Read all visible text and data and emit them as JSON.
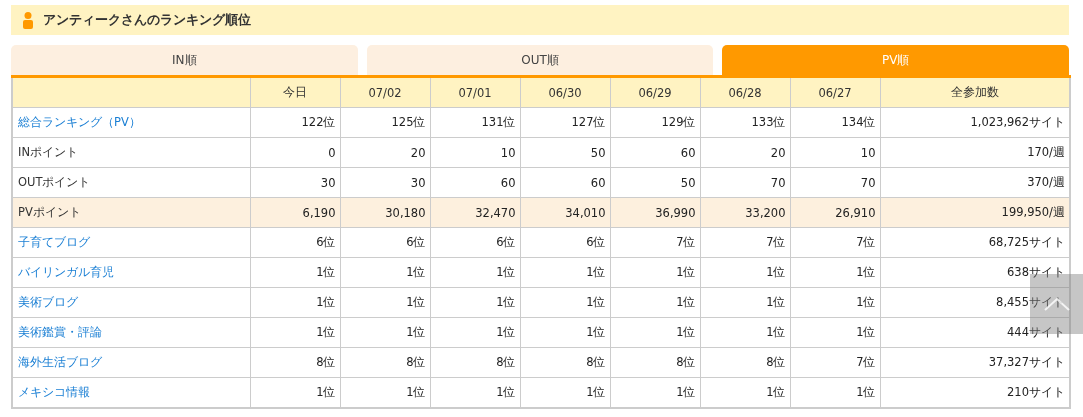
{
  "heading": "アンティークさんのランキング順位",
  "tabs": [
    {
      "label": "IN順",
      "selected": false
    },
    {
      "label": "OUT順",
      "selected": false
    },
    {
      "label": "PV順",
      "selected": true
    }
  ],
  "table": {
    "columns": [
      "",
      "今日",
      "07/02",
      "07/01",
      "06/30",
      "06/29",
      "06/28",
      "06/27",
      "全参加数"
    ],
    "rows": [
      {
        "link": true,
        "highlighted": false,
        "cells": [
          "総合ランキング（PV）",
          "122位",
          "125位",
          "131位",
          "127位",
          "129位",
          "133位",
          "134位",
          "1,023,962サイト"
        ]
      },
      {
        "link": false,
        "highlighted": false,
        "cells": [
          "INポイント",
          "0",
          "20",
          "10",
          "50",
          "60",
          "20",
          "10",
          "170/週"
        ]
      },
      {
        "link": false,
        "highlighted": false,
        "cells": [
          "OUTポイント",
          "30",
          "30",
          "60",
          "60",
          "50",
          "70",
          "70",
          "370/週"
        ]
      },
      {
        "link": false,
        "highlighted": true,
        "cells": [
          "PVポイント",
          "6,190",
          "30,180",
          "32,470",
          "34,010",
          "36,990",
          "33,200",
          "26,910",
          "199,950/週"
        ]
      },
      {
        "link": true,
        "highlighted": false,
        "cells": [
          "子育てブログ",
          "6位",
          "6位",
          "6位",
          "6位",
          "7位",
          "7位",
          "7位",
          "68,725サイト"
        ]
      },
      {
        "link": true,
        "highlighted": false,
        "cells": [
          "バイリンガル育児",
          "1位",
          "1位",
          "1位",
          "1位",
          "1位",
          "1位",
          "1位",
          "638サイト"
        ]
      },
      {
        "link": true,
        "highlighted": false,
        "cells": [
          "美術ブログ",
          "1位",
          "1位",
          "1位",
          "1位",
          "1位",
          "1位",
          "1位",
          "8,455サイト"
        ]
      },
      {
        "link": true,
        "highlighted": false,
        "cells": [
          "美術鑑賞・評論",
          "1位",
          "1位",
          "1位",
          "1位",
          "1位",
          "1位",
          "1位",
          "444サイト"
        ]
      },
      {
        "link": true,
        "highlighted": false,
        "cells": [
          "海外生活ブログ",
          "8位",
          "8位",
          "8位",
          "8位",
          "8位",
          "8位",
          "7位",
          "37,327サイト"
        ]
      },
      {
        "link": true,
        "highlighted": false,
        "cells": [
          "メキシコ情報",
          "1位",
          "1位",
          "1位",
          "1位",
          "1位",
          "1位",
          "1位",
          "210サイト"
        ]
      }
    ]
  }
}
